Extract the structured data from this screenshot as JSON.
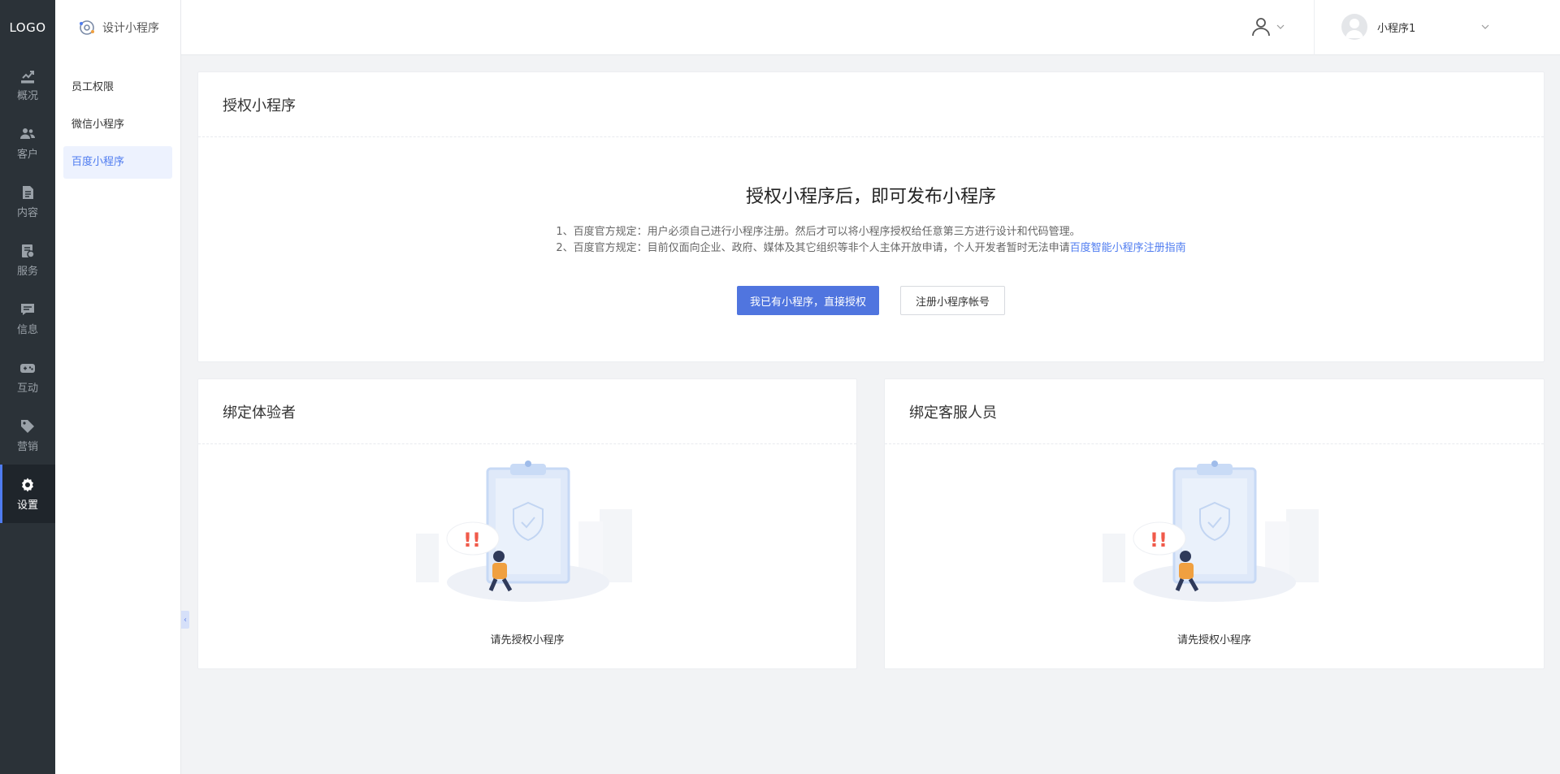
{
  "logo": "LOGO",
  "nav": [
    {
      "label": "概况",
      "icon": "chart-icon"
    },
    {
      "label": "客户",
      "icon": "users-icon"
    },
    {
      "label": "内容",
      "icon": "document-icon"
    },
    {
      "label": "服务",
      "icon": "service-icon"
    },
    {
      "label": "信息",
      "icon": "message-icon"
    },
    {
      "label": "互动",
      "icon": "gamepad-icon"
    },
    {
      "label": "营销",
      "icon": "tag-icon"
    },
    {
      "label": "设置",
      "icon": "gear-icon",
      "active": true
    }
  ],
  "subnav": {
    "title": "设计小程序",
    "items": [
      {
        "label": "员工权限"
      },
      {
        "label": "微信小程序"
      },
      {
        "label": "百度小程序",
        "active": true
      }
    ]
  },
  "header": {
    "account_name": "小程序1"
  },
  "auth": {
    "title": "授权小程序",
    "headline": "授权小程序后，即可发布小程序",
    "rule1": "1、百度官方规定：用户必须自己进行小程序注册。然后才可以将小程序授权给任意第三方进行设计和代码管理。",
    "rule2_prefix": "2、百度官方规定：目前仅面向企业、政府、媒体及其它组织等非个人主体开放申请，个人开发者暂时无法申请",
    "rule2_link": "百度智能小程序注册指南",
    "primary_button": "我已有小程序，直接授权",
    "secondary_button": "注册小程序帐号"
  },
  "tester": {
    "title": "绑定体验者",
    "empty_text": "请先授权小程序"
  },
  "service": {
    "title": "绑定客服人员",
    "empty_text": "请先授权小程序"
  },
  "colors": {
    "accent": "#4f7cf0",
    "primary_button": "#5075df",
    "nav_bg": "#2b3238"
  }
}
